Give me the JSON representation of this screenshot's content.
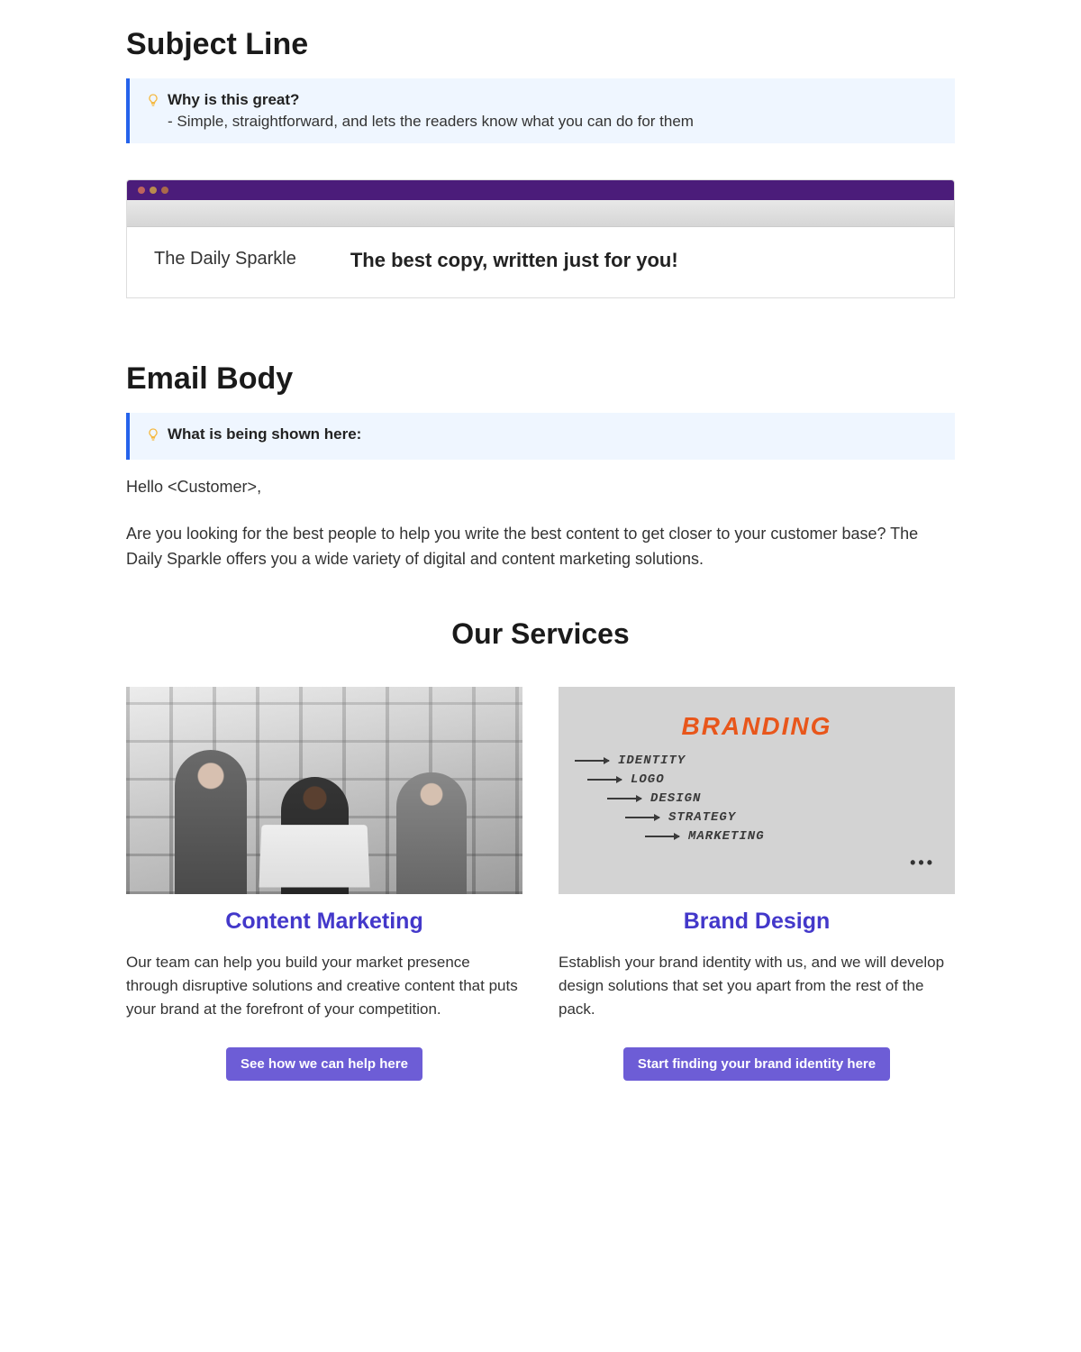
{
  "sections": {
    "subject": {
      "heading": "Subject Line",
      "callout": {
        "title": "Why is this great?",
        "body": "- Simple, straightforward, and lets the readers know what you can do for them"
      },
      "sender": "The Daily Sparkle",
      "subject_text": "The best copy, written just for you!"
    },
    "body": {
      "heading": "Email Body",
      "callout": {
        "title": "What is being shown here:"
      },
      "greeting": "Hello <Customer>,",
      "intro": "Are you looking for the best people to help you write the best content to get closer to your customer base? The Daily Sparkle offers you a wide variety of digital and content marketing solutions.",
      "services_heading": "Our Services",
      "services": [
        {
          "title": "Content Marketing",
          "description": "Our team can help you build your market presence through disruptive solutions and creative content that puts your brand at the forefront of your competition.",
          "cta": "See how we can help here"
        },
        {
          "title": "Brand Design",
          "description": "Establish your brand identity with us, and we will develop design solutions that set you apart from the rest of the pack.",
          "cta": "Start finding your brand identity here",
          "image_heading": "BRANDING",
          "image_items": [
            "IDENTITY",
            "LOGO",
            "DESIGN",
            "STRATEGY",
            "MARKETING"
          ]
        }
      ]
    }
  }
}
